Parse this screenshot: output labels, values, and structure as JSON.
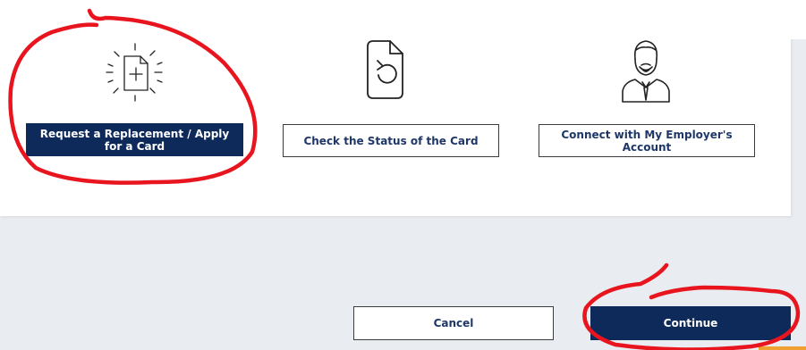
{
  "options": [
    {
      "label": "Request a Replacement / Apply for a Card",
      "icon": "new-document-icon",
      "selected": true
    },
    {
      "label": "Check the Status of the Card",
      "icon": "document-refresh-icon",
      "selected": false
    },
    {
      "label": "Connect with My Employer's Account",
      "icon": "employer-person-icon",
      "selected": false
    }
  ],
  "footer": {
    "cancel_label": "Cancel",
    "continue_label": "Continue"
  },
  "colors": {
    "primary_navy": "#0e2a5a",
    "text_navy": "#1e3768",
    "page_background": "#e9ecf0",
    "annotation_red": "#e8141e"
  }
}
